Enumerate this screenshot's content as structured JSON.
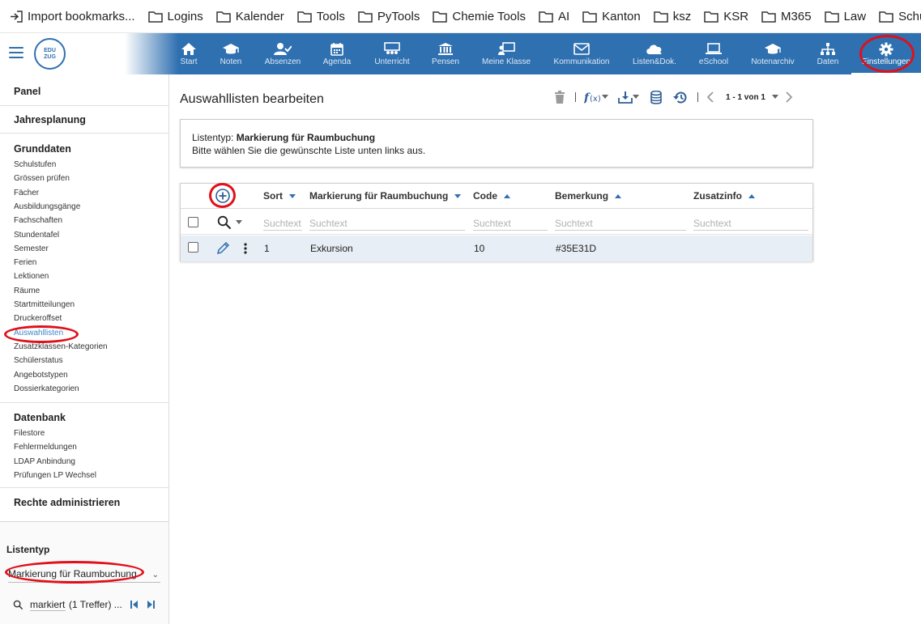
{
  "bookmarks": [
    {
      "label": "Import bookmarks...",
      "icon": "import-icon"
    },
    {
      "label": "Logins",
      "icon": "folder-icon"
    },
    {
      "label": "Kalender",
      "icon": "folder-icon"
    },
    {
      "label": "Tools",
      "icon": "folder-icon"
    },
    {
      "label": "PyTools",
      "icon": "folder-icon"
    },
    {
      "label": "Chemie Tools",
      "icon": "folder-icon"
    },
    {
      "label": "AI",
      "icon": "folder-icon"
    },
    {
      "label": "Kanton",
      "icon": "folder-icon"
    },
    {
      "label": "ksz",
      "icon": "folder-icon"
    },
    {
      "label": "KSR",
      "icon": "folder-icon"
    },
    {
      "label": "M365",
      "icon": "folder-icon"
    },
    {
      "label": "Law",
      "icon": "folder-icon"
    },
    {
      "label": "Schule",
      "icon": "folder-icon"
    }
  ],
  "brand": {
    "logo_top": "EDU",
    "logo_bottom": "ZUG"
  },
  "nav": {
    "items": [
      {
        "label": "Start",
        "icon": "home-icon"
      },
      {
        "label": "Noten",
        "icon": "graduation-cap-icon"
      },
      {
        "label": "Absenzen",
        "icon": "user-check-icon"
      },
      {
        "label": "Agenda",
        "icon": "calendar-icon"
      },
      {
        "label": "Unterricht",
        "icon": "classroom-icon"
      },
      {
        "label": "Pensen",
        "icon": "institution-icon"
      },
      {
        "label": "Meine Klasse",
        "icon": "teacher-board-icon"
      },
      {
        "label": "Kommunikation",
        "icon": "envelope-icon"
      },
      {
        "label": "Listen&Dok.",
        "icon": "cloud-icon"
      },
      {
        "label": "eSchool",
        "icon": "laptop-icon"
      },
      {
        "label": "Notenarchiv",
        "icon": "graduation-cap-icon"
      },
      {
        "label": "Daten",
        "icon": "sitemap-icon"
      },
      {
        "label": "Einstellungen",
        "icon": "gear-icon"
      }
    ],
    "active": "Einstellungen"
  },
  "sidebar": {
    "panel": "Panel",
    "jahresplanung": "Jahresplanung",
    "grunddaten": {
      "title": "Grunddaten",
      "items": [
        "Schulstufen",
        "Grössen prüfen",
        "Fächer",
        "Ausbildungsgänge",
        "Fachschaften",
        "Stundentafel",
        "Semester",
        "Ferien",
        "Lektionen",
        "Räume",
        "Startmitteilungen",
        "Druckeroffset",
        "Auswahllisten",
        "Zusatzklassen-Kategorien",
        "Schülerstatus",
        "Angebotstypen",
        "Dossierkategorien"
      ],
      "active": "Auswahllisten"
    },
    "datenbank": {
      "title": "Datenbank",
      "items": [
        "Filestore",
        "Fehlermeldungen",
        "LDAP Anbindung",
        "Prüfungen LP Wechsel"
      ]
    },
    "rechte": "Rechte administrieren",
    "listentyp": {
      "label": "Listentyp",
      "selected": "Markierung für Raumbuchung",
      "search_value": "markiert",
      "search_result": "(1 Treffer) ..."
    }
  },
  "main": {
    "title": "Auswahllisten bearbeiten",
    "pager": "1 - 1 von 1",
    "info": {
      "prefix": "Listentyp: ",
      "listentyp": "Markierung für Raumbuchung",
      "hint": "Bitte wählen Sie die gewünschte Liste unten links aus."
    },
    "grid": {
      "columns": [
        {
          "key": "sort",
          "label": "Sort",
          "sort": "desc"
        },
        {
          "key": "markierung",
          "label": "Markierung für Raumbuchung",
          "sort": "desc"
        },
        {
          "key": "code",
          "label": "Code",
          "sort": "asc"
        },
        {
          "key": "bemerkung",
          "label": "Bemerkung",
          "sort": "asc"
        },
        {
          "key": "zusatzinfo",
          "label": "Zusatzinfo",
          "sort": "asc"
        }
      ],
      "filter_placeholder": "Suchtext",
      "rows": [
        {
          "sort": "1",
          "markierung": "Exkursion",
          "code": "10",
          "bemerkung": "#35E31D",
          "zusatzinfo": ""
        }
      ]
    }
  },
  "colors": {
    "nav_bg": "#2f70b0",
    "accent": "#3f86c9",
    "row_selected": "#e8eef5",
    "highlight": "#e0101a"
  }
}
